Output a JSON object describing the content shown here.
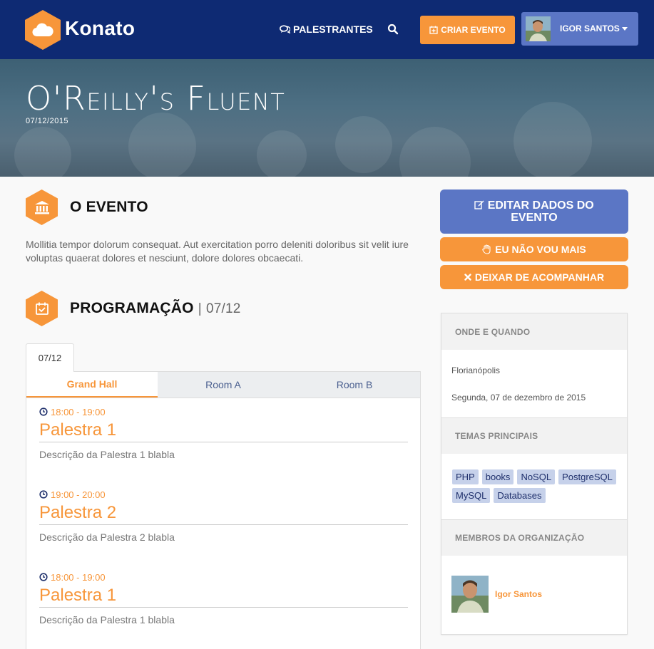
{
  "brand": {
    "name": "Konato",
    "accent": "#f7963a",
    "navy": "#0e2a73",
    "blue": "#5b76c5"
  },
  "nav": {
    "speakers_label": "PALESTRANTES",
    "search_icon": "search-icon",
    "create_event_label": "CRIAR EVENTO",
    "user_name": "IGOR SANTOS"
  },
  "hero": {
    "title": "O'Reilly's Fluent",
    "date": "07/12/2015"
  },
  "event": {
    "heading": "O EVENTO",
    "description": "Mollitia tempor dolorum consequat. Aut exercitation porro deleniti doloribus sit velit iure voluptas quaerat dolores et nesciunt, dolore dolores obcaecati."
  },
  "schedule": {
    "heading": "PROGRAMAÇÃO",
    "separator": "|",
    "heading_date": "07/12",
    "day_tab": "07/12",
    "rooms": [
      "Grand Hall",
      "Room A",
      "Room B"
    ],
    "talks": [
      {
        "time": "18:00 - 19:00",
        "title": "Palestra 1",
        "desc": "Descrição da Palestra 1 blabla"
      },
      {
        "time": "19:00 - 20:00",
        "title": "Palestra 2",
        "desc": "Descrição da Palestra 2 blabla"
      },
      {
        "time": "18:00 - 19:00",
        "title": "Palestra 1",
        "desc": "Descrição da Palestra 1 blabla"
      }
    ]
  },
  "actions": {
    "edit_line1": "EDITAR DADOS DO",
    "edit_line2": "EVENTO",
    "not_going": "EU NÃO VOU MAIS",
    "unfollow": "DEIXAR DE ACOMPANHAR"
  },
  "info": {
    "where_when_heading": "ONDE E QUANDO",
    "city": "Florianópolis",
    "date_long": "Segunda, 07 de dezembro de 2015",
    "topics_heading": "TEMAS PRINCIPAIS",
    "topics": [
      "PHP",
      "books",
      "NoSQL",
      "PostgreSQL",
      "MySQL",
      "Databases"
    ],
    "members_heading": "MEMBROS DA ORGANIZAÇÃO",
    "member_name": "Igor Santos"
  }
}
